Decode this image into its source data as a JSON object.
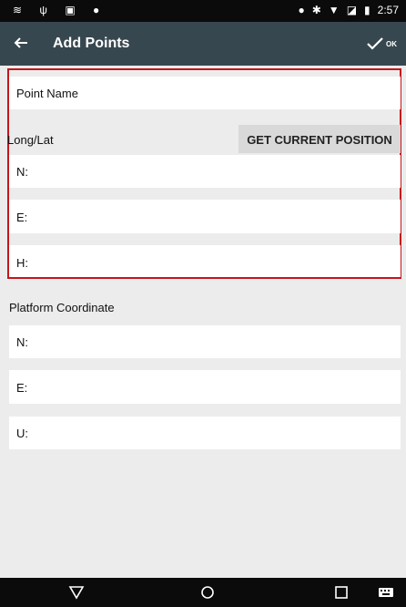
{
  "status_bar": {
    "left_icons": [
      "notification-icon",
      "usb-icon",
      "lock-icon",
      "location-icon"
    ],
    "right_icons": [
      "location-icon",
      "bluetooth-icon",
      "wifi-icon",
      "signal-icon",
      "battery-icon"
    ],
    "time": "2:57"
  },
  "app_bar": {
    "title": "Add Points",
    "ok_label": "OK"
  },
  "form": {
    "point_name_label": "Point Name",
    "long_lat_label": "Long/Lat",
    "get_position_button": "GET CURRENT POSITION",
    "n_label": "N:",
    "e_label": "E:",
    "h_label": "H:"
  },
  "platform": {
    "label": "Platform Coordinate",
    "n_label": "N:",
    "e_label": "E:",
    "u_label": "U:"
  },
  "nav_bar": {
    "icons": [
      "back-icon",
      "home-icon",
      "recents-icon",
      "keyboard-icon"
    ]
  },
  "colors": {
    "app_bar": "#37474f",
    "highlight": "#c4161c",
    "status_bar": "#0b0b0b"
  }
}
